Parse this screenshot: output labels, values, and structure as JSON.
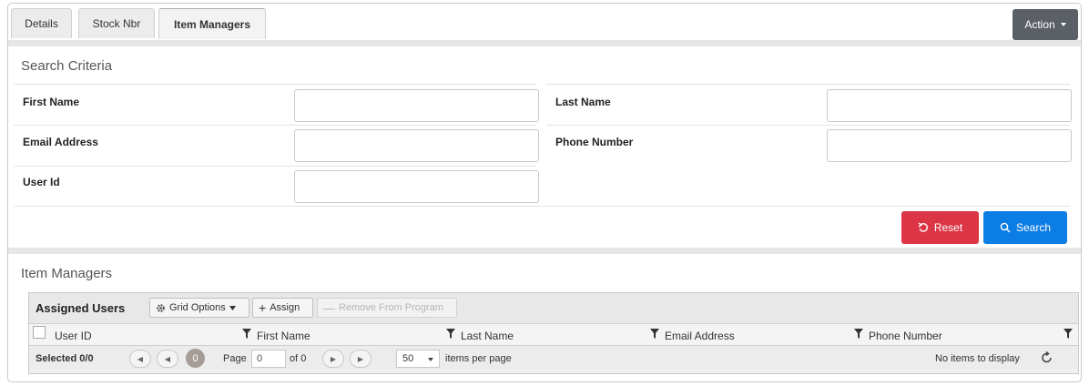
{
  "tabs": [
    {
      "label": "Details"
    },
    {
      "label": "Stock Nbr"
    },
    {
      "label": "Item Managers"
    }
  ],
  "action": {
    "label": "Action"
  },
  "search_criteria": {
    "title": "Search Criteria",
    "fields": {
      "first_name": {
        "label": "First Name",
        "value": ""
      },
      "last_name": {
        "label": "Last Name",
        "value": ""
      },
      "email": {
        "label": "Email Address",
        "value": ""
      },
      "phone": {
        "label": "Phone Number",
        "value": ""
      },
      "user_id": {
        "label": "User Id",
        "value": ""
      }
    },
    "reset_label": "Reset",
    "search_label": "Search"
  },
  "item_managers": {
    "title": "Item Managers",
    "grid": {
      "title": "Assigned Users",
      "grid_options_label": "Grid Options",
      "assign_label": "Assign",
      "remove_label": "Remove From Program",
      "columns": [
        "User ID",
        "First Name",
        "Last Name",
        "Email Address",
        "Phone Number"
      ],
      "rows": [],
      "pager": {
        "selected": "Selected 0/0",
        "current_page": "0",
        "page_label": "Page",
        "page_value": "0",
        "of_label": "of 0",
        "page_size": "50",
        "items_per_page": "items per page",
        "empty_text": "No items to display"
      }
    }
  },
  "colors": {
    "reset": "#dc3545",
    "search": "#0d7de6",
    "action": "#5b6066"
  }
}
